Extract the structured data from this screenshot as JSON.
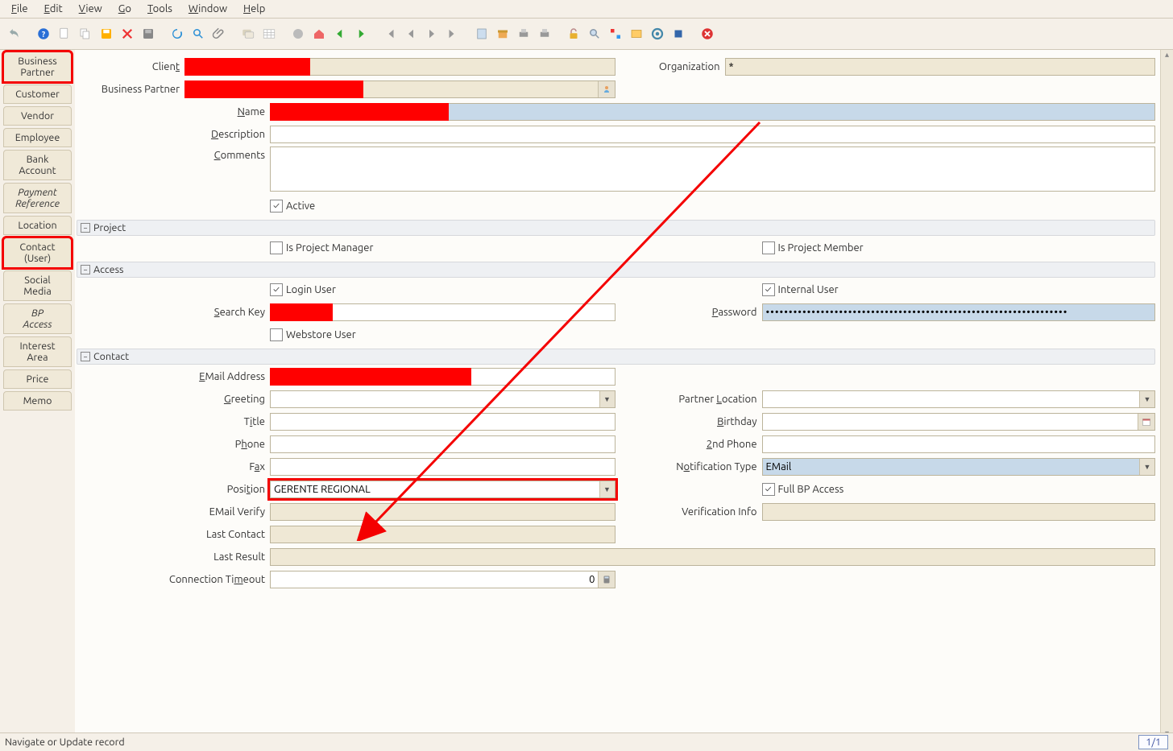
{
  "menu": {
    "file": "File",
    "edit": "Edit",
    "view": "View",
    "go": "Go",
    "tools": "Tools",
    "window": "Window",
    "help": "Help"
  },
  "sidetabs": {
    "business_partner": "Business Partner",
    "customer": "Customer",
    "vendor": "Vendor",
    "employee": "Employee",
    "bank_account": "Bank Account",
    "payment_reference": "Payment Reference",
    "location": "Location",
    "contact_user": "Contact (User)",
    "social_media": "Social Media",
    "bp_access": "BP Access",
    "interest_area": "Interest Area",
    "price": "Price",
    "memo": "Memo"
  },
  "labels": {
    "client": "Client",
    "organization": "Organization",
    "business_partner": "Business Partner",
    "name": "Name",
    "description": "Description",
    "comments": "Comments",
    "active": "Active",
    "project": "Project",
    "is_pm": "Is Project Manager",
    "is_pmem": "Is Project Member",
    "access": "Access",
    "login_user": "Login User",
    "internal_user": "Internal User",
    "search_key": "Search Key",
    "password": "Password",
    "webstore_user": "Webstore User",
    "contact": "Contact",
    "email": "EMail Address",
    "greeting": "Greeting",
    "partner_loc": "Partner Location",
    "title": "Title",
    "birthday": "Birthday",
    "phone": "Phone",
    "phone2": "2nd Phone",
    "fax": "Fax",
    "notif": "Notification Type",
    "position": "Position",
    "full_bp": "Full BP Access",
    "email_verify": "EMail Verify",
    "verif_info": "Verification Info",
    "last_contact": "Last Contact",
    "last_result": "Last Result",
    "conn_timeout": "Connection Timeout"
  },
  "values": {
    "organization": "*",
    "password_mask": "••••••••••••••••••••••••••••••••••••••••••••••••••••••••••••••••••",
    "notif": "EMail",
    "position": "GERENTE REGIONAL",
    "conn_timeout": "0"
  },
  "checks": {
    "active": true,
    "login_user": true,
    "internal_user": true,
    "full_bp": true,
    "is_pm": false,
    "is_pmem": false,
    "webstore": false
  },
  "status": {
    "msg": "Navigate or Update record",
    "rec": "1/1"
  }
}
